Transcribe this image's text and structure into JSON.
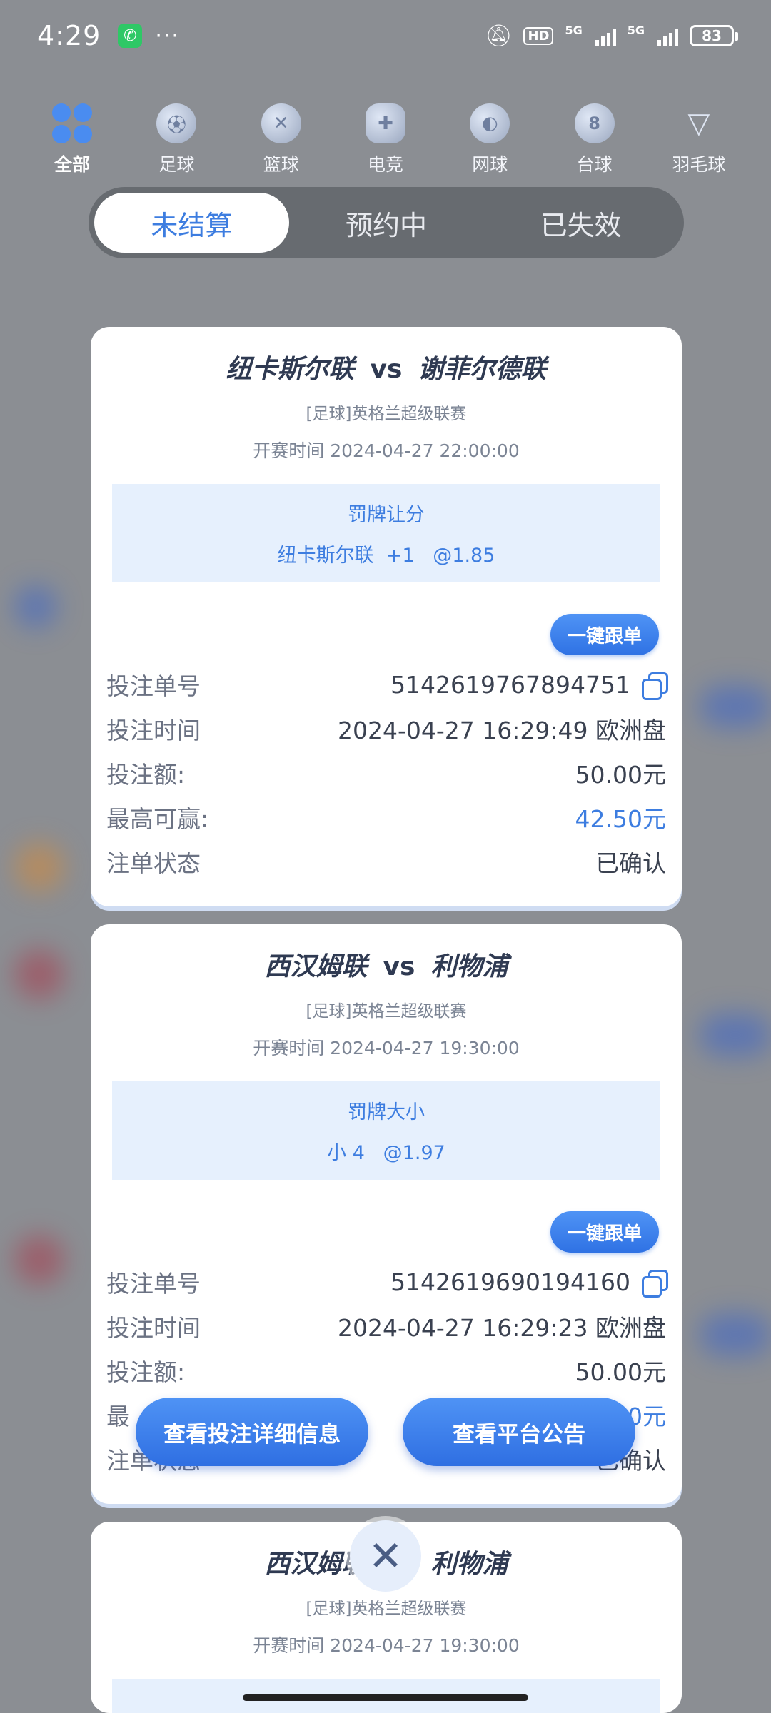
{
  "status_bar": {
    "time": "4:29",
    "call_icon": "phone-icon",
    "more": "···",
    "hd": "HD",
    "network1": "5G",
    "network2": "5G",
    "battery": "83"
  },
  "categories": [
    {
      "label": "全部",
      "icon": "all-grid-icon",
      "active": true
    },
    {
      "label": "足球",
      "icon": "football-icon"
    },
    {
      "label": "篮球",
      "icon": "basketball-icon"
    },
    {
      "label": "电竞",
      "icon": "esports-icon"
    },
    {
      "label": "网球",
      "icon": "tennis-icon"
    },
    {
      "label": "台球",
      "icon": "billiards-icon"
    },
    {
      "label": "羽毛球",
      "icon": "badminton-icon"
    }
  ],
  "tabs": [
    {
      "label": "未结算",
      "active": true
    },
    {
      "label": "预约中"
    },
    {
      "label": "已失效"
    }
  ],
  "cards": [
    {
      "home": "纽卡斯尔联",
      "vs": "vs",
      "away": "谢菲尔德联",
      "league": "[足球]英格兰超级联赛",
      "kickoff": "开赛时间 2024-04-27 22:00:00",
      "bet_type": "罚牌让分",
      "bet_pick": "纽卡斯尔联  +1   @1.85",
      "follow": "一键跟单",
      "rows": [
        {
          "k": "投注单号",
          "v": "5142619767894751"
        },
        {
          "k": "投注时间",
          "v": "2024-04-27 16:29:49 欧洲盘"
        },
        {
          "k": "投注额:",
          "v": "50.00元"
        },
        {
          "k": "最高可赢:",
          "v": "42.50元"
        },
        {
          "k": "注单状态",
          "v": "已确认"
        }
      ]
    },
    {
      "home": "西汉姆联",
      "vs": "vs",
      "away": "利物浦",
      "league": "[足球]英格兰超级联赛",
      "kickoff": "开赛时间 2024-04-27 19:30:00",
      "bet_type": "罚牌大小",
      "bet_pick": "小 4   @1.97",
      "follow": "一键跟单",
      "rows": [
        {
          "k": "投注单号",
          "v": "5142619690194160"
        },
        {
          "k": "投注时间",
          "v": "2024-04-27 16:29:23 欧洲盘"
        },
        {
          "k": "投注额:",
          "v": "50.00元"
        },
        {
          "k": "最",
          "v": "0元"
        },
        {
          "k": "注单状态",
          "v": "已确认"
        }
      ]
    },
    {
      "home": "西汉姆联",
      "vs": "vs",
      "away": "利物浦",
      "league": "[足球]英格兰超级联赛",
      "kickoff": "开赛时间 2024-04-27 19:30:00"
    }
  ],
  "overlay": {
    "details_button": "查看投注详细信息",
    "notice_button": "查看平台公告",
    "close": "✕"
  },
  "colors": {
    "accent": "#3d7de0",
    "overlay_bg": "#8b8e93"
  }
}
